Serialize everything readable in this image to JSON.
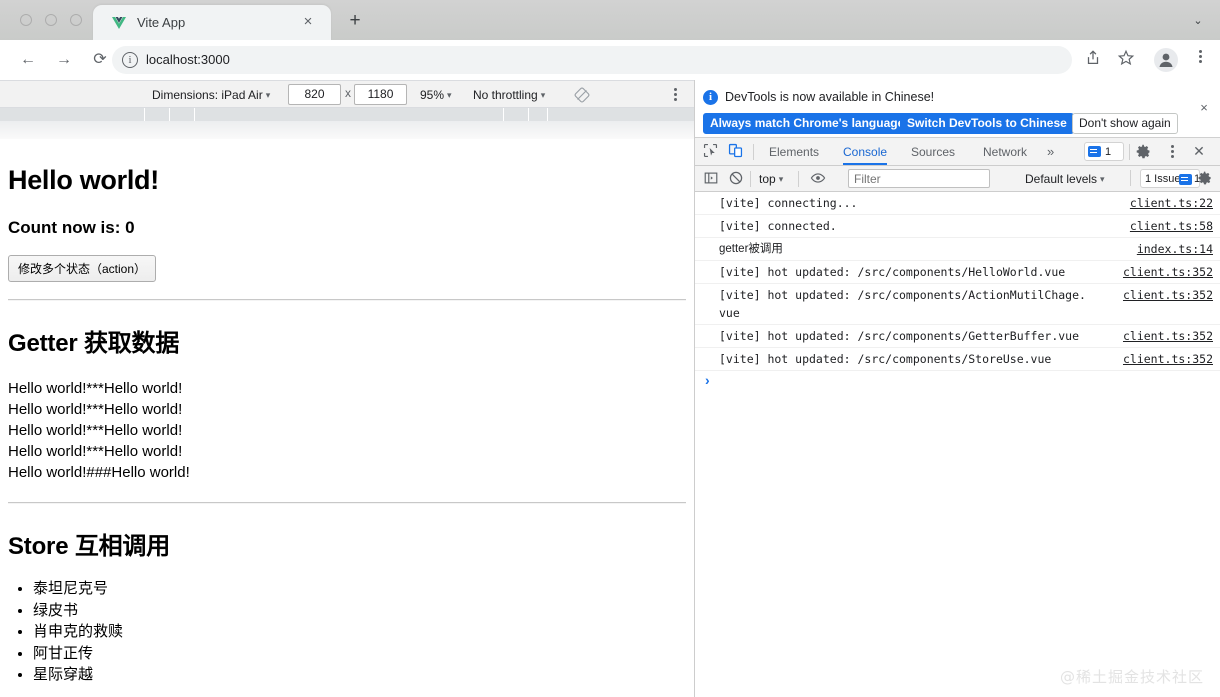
{
  "browser": {
    "tab": {
      "title": "Vite App",
      "favicon": "vue-logo-icon",
      "close_label": "×"
    },
    "new_tab_label": "+",
    "tabstrip_chevron": "⌄",
    "nav": {
      "back": "←",
      "forward": "→",
      "reload": "⟳"
    },
    "omnibox": {
      "url": "localhost:3000",
      "info_icon": "i"
    },
    "toolbar_icons": [
      "share-icon",
      "bookmark-star-icon",
      "profile-avatar",
      "chrome-menu-icon"
    ]
  },
  "device_toolbar": {
    "dimensions_label": "Dimensions: iPad Air",
    "width": "820",
    "height": "1180",
    "multiply": "x",
    "zoom": "95%",
    "throttling": "No throttling",
    "rotate_icon": "rotate-icon",
    "more_icon": "more-options-icon",
    "caret": "▾"
  },
  "page": {
    "title": "Hello world!",
    "count_text": "Count now is: 0",
    "action_button": "修改多个状态（action）",
    "getter_heading": "Getter 获取数据",
    "getter_lines": [
      "Hello world!***Hello world!",
      "Hello world!***Hello world!",
      "Hello world!***Hello world!",
      "Hello world!***Hello world!",
      "Hello world!###Hello world!"
    ],
    "store_heading": "Store 互相调用",
    "store_items": [
      "泰坦尼克号",
      "绿皮书",
      "肖申克的救赎",
      "阿甘正传",
      "星际穿越"
    ]
  },
  "devtools": {
    "banner": {
      "text": "DevTools is now available in Chinese!",
      "info_icon": "info-icon",
      "close_icon": "×",
      "buttons": [
        {
          "label": "Always match Chrome's language",
          "style": "primary"
        },
        {
          "label": "Switch DevTools to Chinese",
          "style": "primary"
        },
        {
          "label": "Don't show again",
          "style": "plain"
        }
      ]
    },
    "tabs": [
      {
        "label": "Elements",
        "active": false
      },
      {
        "label": "Console",
        "active": true
      },
      {
        "label": "Sources",
        "active": false
      },
      {
        "label": "Network",
        "active": false
      }
    ],
    "tabs_overflow": "»",
    "message_badge_count": "1",
    "tool_icons": [
      "inspect-element-icon",
      "device-toolbar-icon",
      "settings-gear-icon",
      "devtools-menu-icon",
      "devtools-close-icon"
    ],
    "filters": {
      "sidebar_icon": "console-sidebar-icon",
      "clear_icon": "clear-console-icon",
      "context": "top",
      "eye_icon": "live-expression-icon",
      "filter_placeholder": "Filter",
      "filter_value": "",
      "levels": "Default levels",
      "issues_label": "1 Issue:",
      "issues_count": "1",
      "gear_icon": "console-settings-icon",
      "caret": "▾"
    },
    "console_messages": [
      {
        "text": "[vite] connecting...",
        "source": "client.ts:22"
      },
      {
        "text": "[vite] connected.",
        "source": "client.ts:58"
      },
      {
        "text": "getter被调用",
        "source": "index.ts:14"
      },
      {
        "text": "[vite] hot updated: /src/components/HelloWorld.vue",
        "source": "client.ts:352"
      },
      {
        "text": "[vite] hot updated: /src/components/ActionMutilChage.vue",
        "source": "client.ts:352"
      },
      {
        "text": "[vite] hot updated: /src/components/GetterBuffer.vue",
        "source": "client.ts:352"
      },
      {
        "text": "[vite] hot updated: /src/components/StoreUse.vue",
        "source": "client.ts:352"
      }
    ],
    "prompt_symbol": "›"
  },
  "watermark": "@稀土掘金技术社区",
  "colors": {
    "accent_blue": "#1a73e8",
    "tab_active_blue": "#1967d2",
    "chrome_gray": "#d2d2d2",
    "toolbar_bg": "#f3f3f3"
  }
}
